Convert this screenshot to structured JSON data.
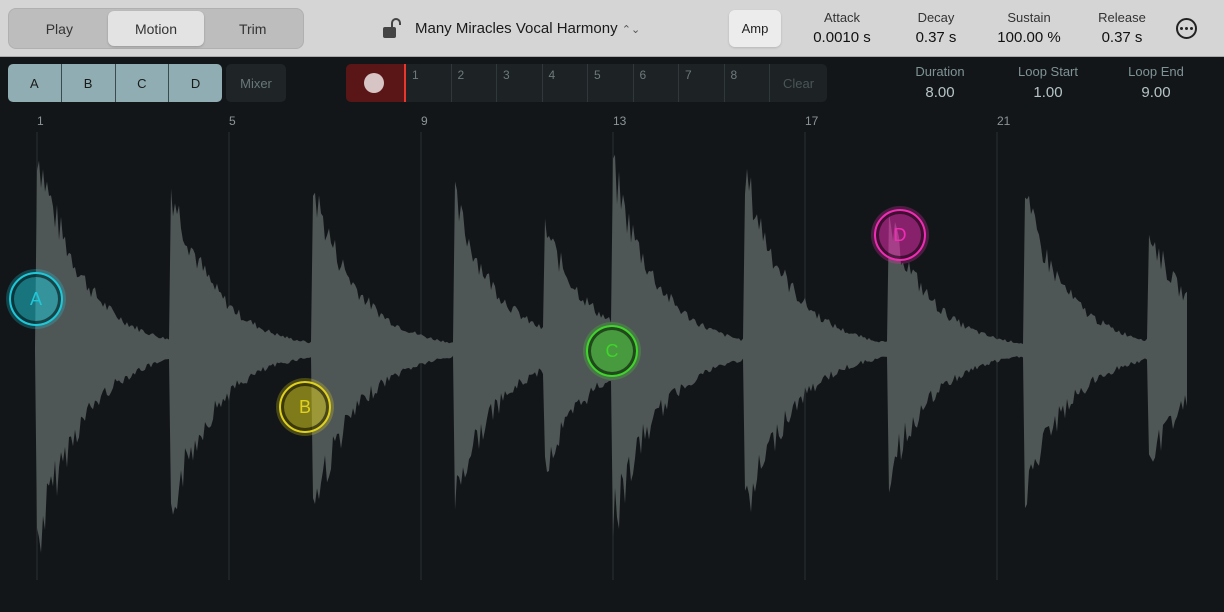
{
  "modes": [
    {
      "label": "Play"
    },
    {
      "label": "Motion",
      "active": true
    },
    {
      "label": "Trim"
    }
  ],
  "patch": {
    "title": "Many Miracles Vocal Harmony",
    "lock_icon": "unlocked-lock-icon"
  },
  "amp_label": "Amp",
  "envelope": [
    {
      "label": "Attack",
      "value": "0.0010 s"
    },
    {
      "label": "Decay",
      "value": "0.37 s"
    },
    {
      "label": "Sustain",
      "value": "100.00 %"
    },
    {
      "label": "Release",
      "value": "0.37 s"
    }
  ],
  "pads": [
    "A",
    "B",
    "C",
    "D"
  ],
  "mixer_label": "Mixer",
  "steps": [
    "1",
    "2",
    "3",
    "4",
    "5",
    "6",
    "7",
    "8"
  ],
  "clear_label": "Clear",
  "loop": [
    {
      "label": "Duration",
      "value": "8.00"
    },
    {
      "label": "Loop Start",
      "value": "1.00"
    },
    {
      "label": "Loop End",
      "value": "9.00"
    }
  ],
  "ruler": [
    "1",
    "5",
    "9",
    "13",
    "17",
    "21"
  ],
  "pucks": [
    {
      "label": "A",
      "color": "#1ec8d8"
    },
    {
      "label": "B",
      "color": "#e0d21c"
    },
    {
      "label": "C",
      "color": "#3fd52a"
    },
    {
      "label": "D",
      "color": "#f02cb4"
    }
  ]
}
